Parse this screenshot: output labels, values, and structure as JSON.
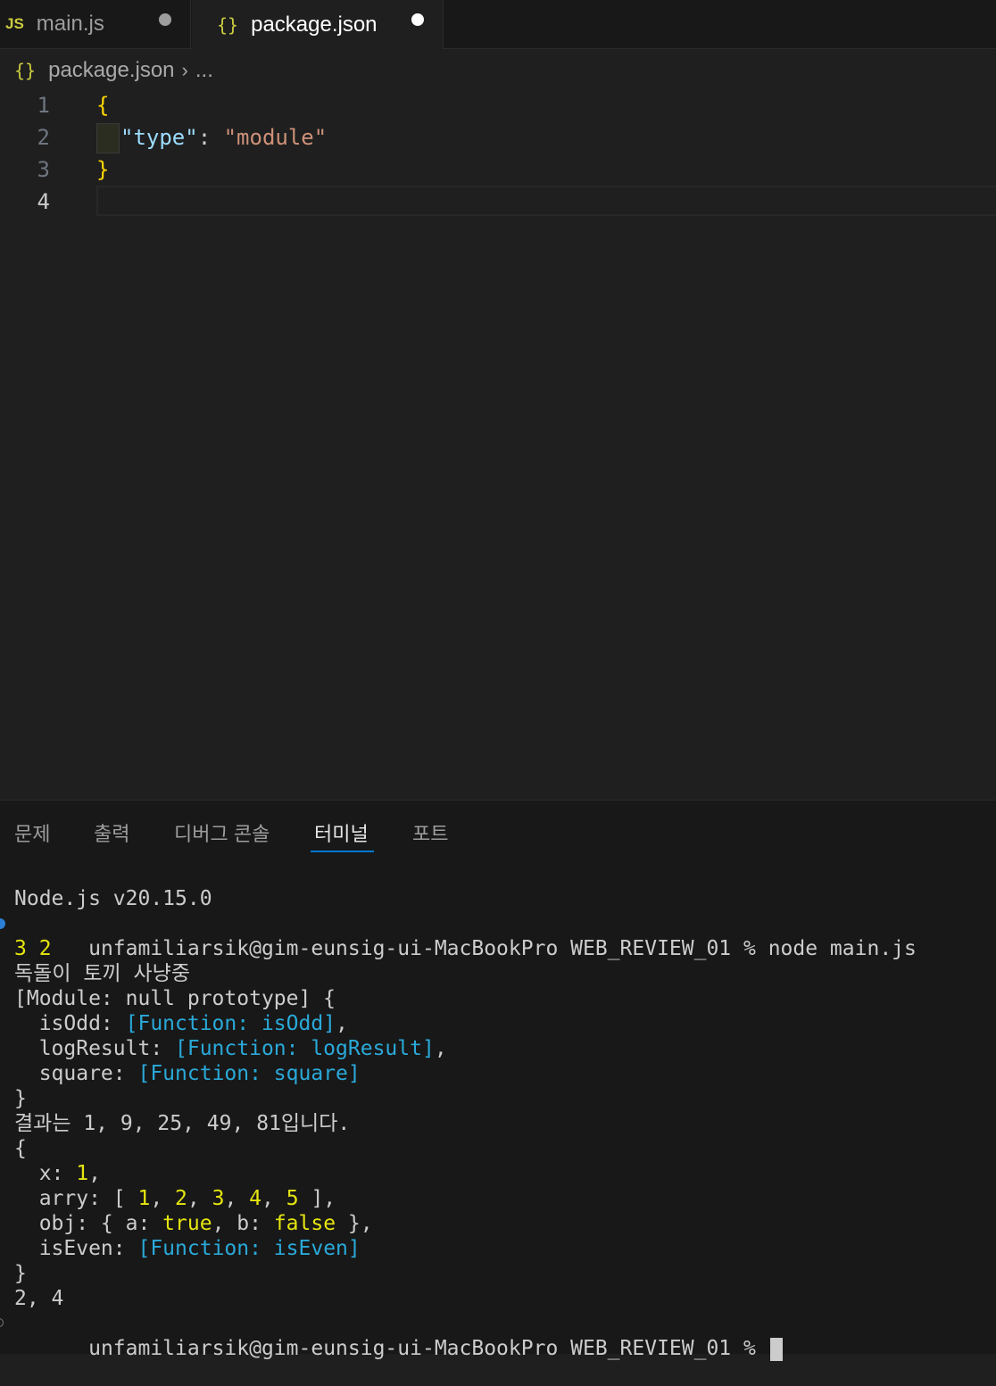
{
  "tabs": [
    {
      "icon": "JS",
      "label": "main.js",
      "modified": true
    },
    {
      "icon": "{}",
      "label": "package.json",
      "modified": true
    }
  ],
  "breadcrumb": {
    "icon": "{}",
    "file": "package.json",
    "rest": "..."
  },
  "editor": {
    "lines": [
      {
        "number": "1",
        "open": "{"
      },
      {
        "number": "2",
        "key": "\"type\"",
        "colon": ": ",
        "value": "\"module\""
      },
      {
        "number": "3",
        "close": "}"
      },
      {
        "number": "4"
      }
    ]
  },
  "panel": {
    "tabs": [
      "문제",
      "출력",
      "디버그 콘솔",
      "터미널",
      "포트"
    ],
    "active_tab": "터미널"
  },
  "terminal": {
    "node_version": "Node.js v20.15.0",
    "prompt_command": "unfamiliarsik@gim-eunsig-ui-MacBookPro WEB_REVIEW_01 % node main.js",
    "out1": "3 2",
    "out2": "독돌이 토끼 사냥중",
    "module_open": "[Module: null prototype] {",
    "m1_key": "  isOdd: ",
    "m1_val": "[Function: isOdd]",
    "m2_key": "  logResult: ",
    "m2_val": "[Function: logResult]",
    "m3_key": "  square: ",
    "m3_val": "[Function: square]",
    "close1": "}",
    "result": "결과는 1, 9, 25, 49, 81입니다.",
    "obj_open": "{",
    "x_key": "  x: ",
    "x_val": "1",
    "arry_key": "  arry: [ ",
    "arry_vals": [
      "1",
      "2",
      "3",
      "4",
      "5"
    ],
    "arry_close": " ],",
    "obj_key": "  obj: { a: ",
    "obj_a": "true",
    "obj_mid": ", b: ",
    "obj_b": "false",
    "obj_end": " },",
    "even_key": "  isEven: ",
    "even_val": "[Function: isEven]",
    "close2": "}",
    "out_last": "2, 4",
    "prompt_final": "unfamiliarsik@gim-eunsig-ui-MacBookPro WEB_REVIEW_01 % "
  }
}
